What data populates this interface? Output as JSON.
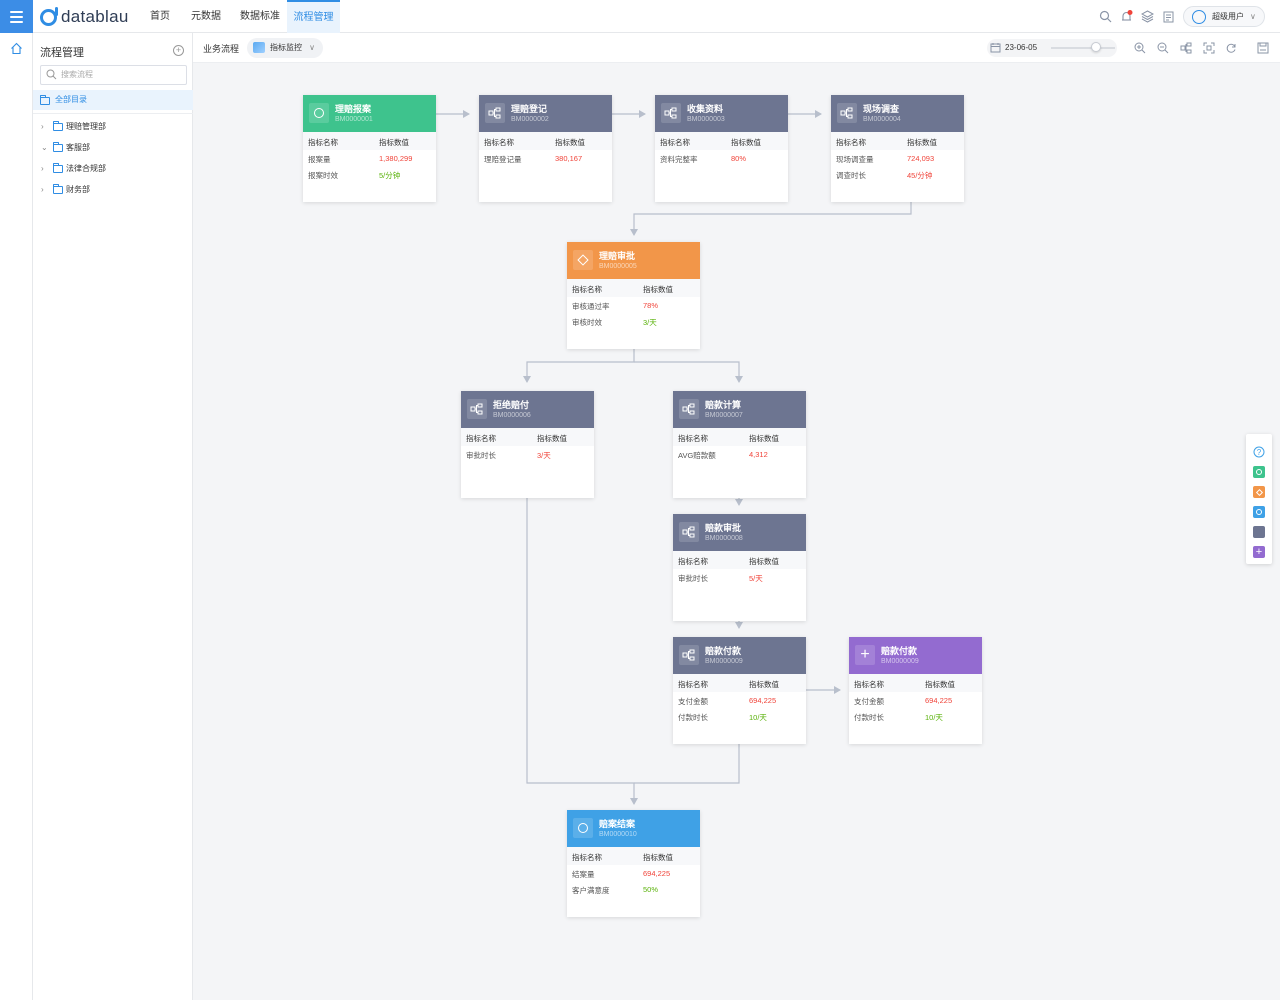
{
  "app": {
    "logo_text": "datablau"
  },
  "nav": {
    "items": [
      "首页",
      "元数据",
      "数据标准",
      "流程管理"
    ],
    "active": "流程管理"
  },
  "user": {
    "name": "超级用户",
    "notification_badge": "1"
  },
  "sidebar": {
    "title": "流程管理",
    "search_placeholder": "搜索流程",
    "root": "全部目录",
    "tree": [
      {
        "label": "理赔管理部",
        "expanded": false
      },
      {
        "label": "客服部",
        "expanded": true
      },
      {
        "label": "法律合规部",
        "expanded": false
      },
      {
        "label": "财务部",
        "expanded": false
      }
    ]
  },
  "toolbar": {
    "flow_title": "业务流程",
    "view_select": "指标监控",
    "date": "23-06-05"
  },
  "table_headers": {
    "name": "指标名称",
    "value": "指标数值"
  },
  "nodes": [
    {
      "id": "n1",
      "title": "理赔报案",
      "code": "BM0000001",
      "kind": "start",
      "color": "#3ec38d",
      "rows": [
        {
          "name": "报案量",
          "value": "1,380,299",
          "status": "red"
        },
        {
          "name": "报案时效",
          "value": "5/分钟",
          "status": "green"
        }
      ]
    },
    {
      "id": "n2",
      "title": "理赔登记",
      "code": "BM0000002",
      "kind": "task",
      "color": "#6d7591",
      "rows": [
        {
          "name": "理赔登记量",
          "value": "380,167",
          "status": "red"
        }
      ]
    },
    {
      "id": "n3",
      "title": "收集资料",
      "code": "BM0000003",
      "kind": "task",
      "color": "#6d7591",
      "rows": [
        {
          "name": "资料完整率",
          "value": "80%",
          "status": "red"
        }
      ]
    },
    {
      "id": "n4",
      "title": "现场调查",
      "code": "BM0000004",
      "kind": "task",
      "color": "#6d7591",
      "rows": [
        {
          "name": "现场调查量",
          "value": "724,093",
          "status": "red"
        },
        {
          "name": "调查时长",
          "value": "45/分钟",
          "status": "red"
        }
      ]
    },
    {
      "id": "n5",
      "title": "理赔审批",
      "code": "BM0000005",
      "kind": "gateway",
      "color": "#f29649",
      "rows": [
        {
          "name": "审核通过率",
          "value": "78%",
          "status": "red"
        },
        {
          "name": "审核时效",
          "value": "3/天",
          "status": "green"
        }
      ]
    },
    {
      "id": "n6",
      "title": "拒绝赔付",
      "code": "BM0000006",
      "kind": "task",
      "color": "#6d7591",
      "rows": [
        {
          "name": "审批时长",
          "value": "3/天",
          "status": "red"
        }
      ]
    },
    {
      "id": "n7",
      "title": "赔款计算",
      "code": "BM0000007",
      "kind": "task",
      "color": "#6d7591",
      "rows": [
        {
          "name": "AVG赔款额",
          "value": "4,312",
          "status": "red"
        }
      ]
    },
    {
      "id": "n8",
      "title": "赔款审批",
      "code": "BM0000008",
      "kind": "task",
      "color": "#6d7591",
      "rows": [
        {
          "name": "审批时长",
          "value": "5/天",
          "status": "red"
        }
      ]
    },
    {
      "id": "n9",
      "title": "赔款付款",
      "code": "BM0000009",
      "kind": "task",
      "color": "#6d7591",
      "rows": [
        {
          "name": "支付金额",
          "value": "694,225",
          "status": "red"
        },
        {
          "name": "付款时长",
          "value": "10/天",
          "status": "green"
        }
      ]
    },
    {
      "id": "n10",
      "title": "赔款付款",
      "code": "BM0000009",
      "kind": "subprocess",
      "color": "#936bd0",
      "rows": [
        {
          "name": "支付金额",
          "value": "694,225",
          "status": "red"
        },
        {
          "name": "付款时长",
          "value": "10/天",
          "status": "green"
        }
      ]
    },
    {
      "id": "n11",
      "title": "赔案结案",
      "code": "BM0000010",
      "kind": "end",
      "color": "#3fa1e6",
      "rows": [
        {
          "name": "结案量",
          "value": "694,225",
          "status": "red"
        },
        {
          "name": "客户满意度",
          "value": "50%",
          "status": "green"
        }
      ]
    }
  ],
  "palette": [
    "help-icon",
    "start-node-icon",
    "gateway-node-icon",
    "end-node-icon",
    "task-node-icon",
    "subprocess-node-icon"
  ]
}
